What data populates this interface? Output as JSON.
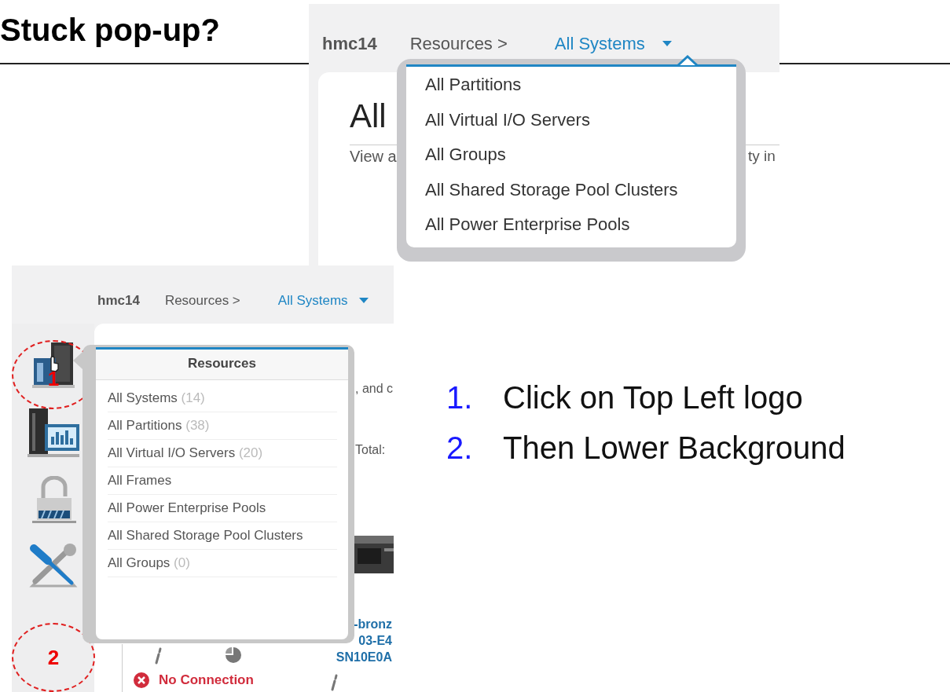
{
  "slide": {
    "title": "Stuck pop-up?"
  },
  "top_screenshot": {
    "breadcrumb": {
      "host": "hmc14",
      "section": "Resources >",
      "current": "All Systems"
    },
    "page_title": "All",
    "description_start": "View a",
    "description_end": "ty in",
    "dropdown": {
      "items": [
        {
          "label": "All Partitions"
        },
        {
          "label": "All Virtual I/O Servers"
        },
        {
          "label": "All Groups"
        },
        {
          "label": "All Shared Storage Pool Clusters"
        },
        {
          "label": "All Power Enterprise Pools"
        }
      ]
    }
  },
  "bottom_screenshot": {
    "breadcrumb": {
      "host": "hmc14",
      "section": "Resources >",
      "current": "All Systems"
    },
    "markers": [
      {
        "label": "1"
      },
      {
        "label": "2"
      }
    ],
    "popup": {
      "title": "Resources",
      "items": [
        {
          "label": "All Systems",
          "count": "(14)"
        },
        {
          "label": "All Partitions",
          "count": "(38)"
        },
        {
          "label": "All Virtual I/O Servers",
          "count": "(20)"
        },
        {
          "label": "All Frames"
        },
        {
          "label": "All Power Enterprise Pools"
        },
        {
          "label": "All Shared Storage Pool Clusters"
        },
        {
          "label": "All Groups",
          "count": "(0)"
        }
      ]
    },
    "fragment_text": ", and c",
    "total_label": "Total:",
    "system_name_lines": [
      "-bronz",
      "03-E4",
      "SN10E0A"
    ],
    "status": "No Connection"
  },
  "steps": [
    {
      "number": "1.",
      "text": "Click on Top Left logo"
    },
    {
      "number": "2.",
      "text": "Then Lower Background"
    }
  ]
}
